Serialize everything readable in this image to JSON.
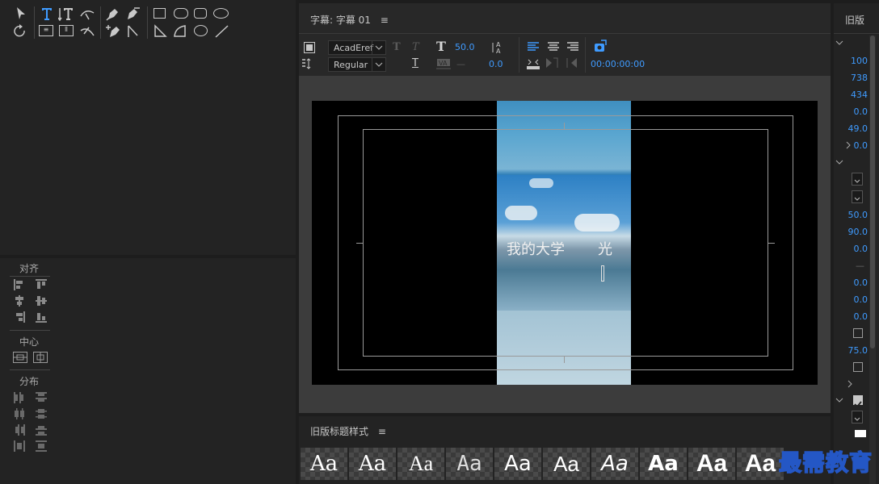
{
  "tools_panel": {},
  "align_panel": {
    "align_label": "对齐",
    "center_label": "中心",
    "distribute_label": "分布"
  },
  "title_panel": {
    "tab_title": "字幕: 字幕 01",
    "menu_icon": "hamburger-icon",
    "font_family": "AcadEref",
    "font_style": "Regular",
    "font_size": "50.0",
    "kerning_dash": "—",
    "leading": "0.0",
    "timecode": "00:00:00:00"
  },
  "canvas": {
    "text_left": "我的大学",
    "text_right": "光"
  },
  "styles_panel": {
    "title": "旧版标题样式",
    "tiles": [
      "Aa",
      "Aa",
      "Aa",
      "Aa",
      "Aa",
      "Aa",
      "Aa",
      "Aa",
      "Aa",
      "Aa"
    ]
  },
  "properties_panel": {
    "title": "旧版",
    "values": [
      "100",
      "738",
      "434",
      "0.0",
      "49.0",
      "0.0",
      "50.0",
      "90.0",
      "0.0",
      "—",
      "0.0",
      "0.0",
      "0.0",
      "75.0"
    ]
  },
  "watermark": "最需教育",
  "colors": {
    "accent": "#3f9bff",
    "panel": "#232323",
    "background": "#1d1d1d"
  }
}
